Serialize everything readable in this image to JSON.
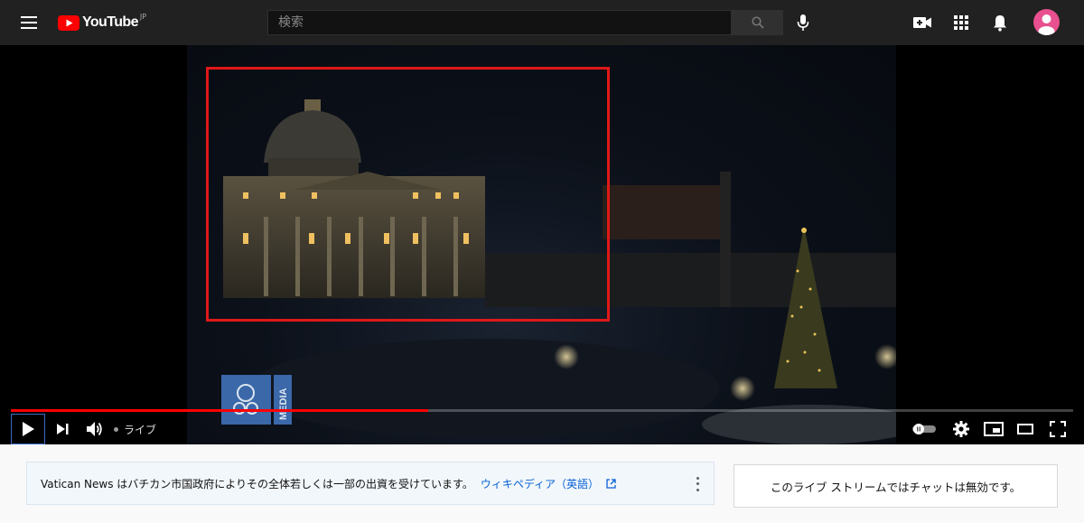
{
  "header": {
    "logo_text": "YouTube",
    "region": "JP",
    "search_placeholder": "検索",
    "icons": [
      "menu-icon",
      "search-icon",
      "mic-icon",
      "create-video-icon",
      "apps-icon",
      "bell-icon",
      "avatar-icon"
    ]
  },
  "player": {
    "live_label": "ライブ",
    "progress": 0.393,
    "overlay_logo": "MEDIA",
    "highlight_color": "#e01818",
    "progress_color": "#ff0000"
  },
  "info_panel": {
    "text": "Vatican News はバチカン市国政府によりその全体若しくは一部の出資を受けています。",
    "link": "ウィキペディア（英語）"
  },
  "chat_panel": {
    "text": "このライブ ストリームではチャットは無効です。"
  }
}
